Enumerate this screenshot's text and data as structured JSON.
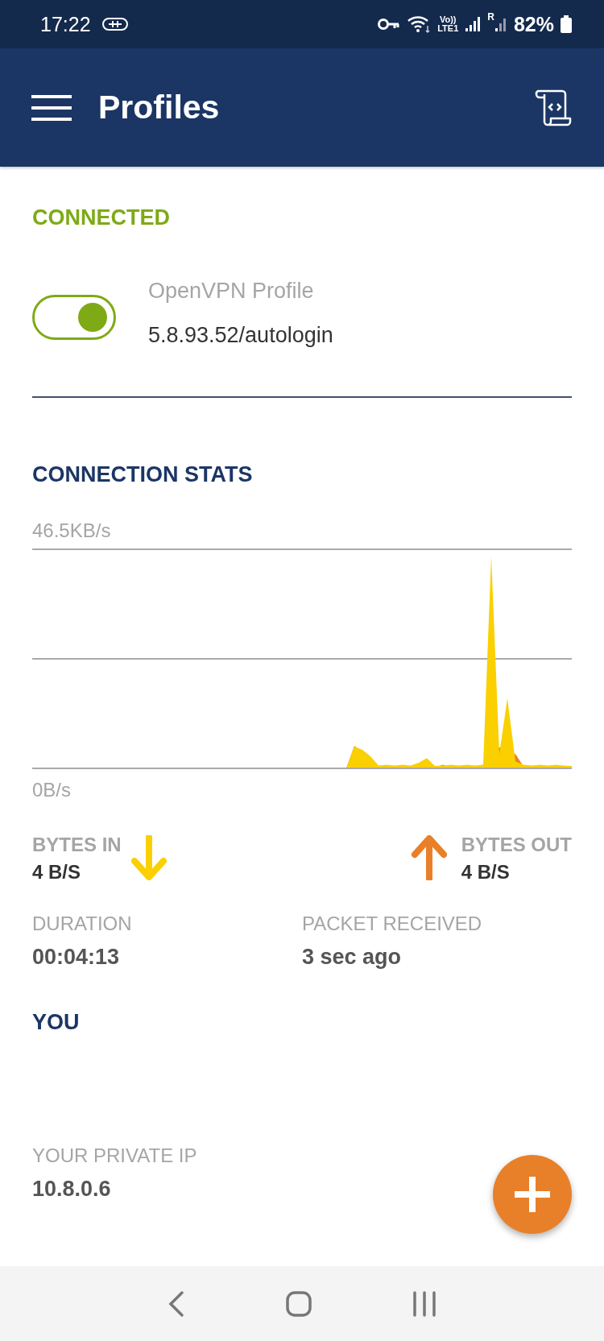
{
  "status_bar": {
    "time": "17:22",
    "volte": "Vo))",
    "lte": "LTE1",
    "roaming": "R",
    "battery": "82%"
  },
  "app_bar": {
    "title": "Profiles"
  },
  "connection": {
    "status": "CONNECTED",
    "on": true,
    "profile_name": "OpenVPN Profile",
    "address": "5.8.93.52/autologin"
  },
  "stats": {
    "title": "CONNECTION STATS",
    "graph": {
      "max_label": "46.5KB/s",
      "min_label": "0B/s"
    },
    "bytes_in": {
      "label": "BYTES IN",
      "value": "4 B/S"
    },
    "bytes_out": {
      "label": "BYTES OUT",
      "value": "4 B/S"
    },
    "duration": {
      "label": "DURATION",
      "value": "00:04:13"
    },
    "packet": {
      "label": "PACKET RECEIVED",
      "value": "3 sec ago"
    }
  },
  "you": {
    "title": "YOU",
    "private_ip": {
      "label": "YOUR PRIVATE IP",
      "value": "10.8.0.6"
    }
  }
}
